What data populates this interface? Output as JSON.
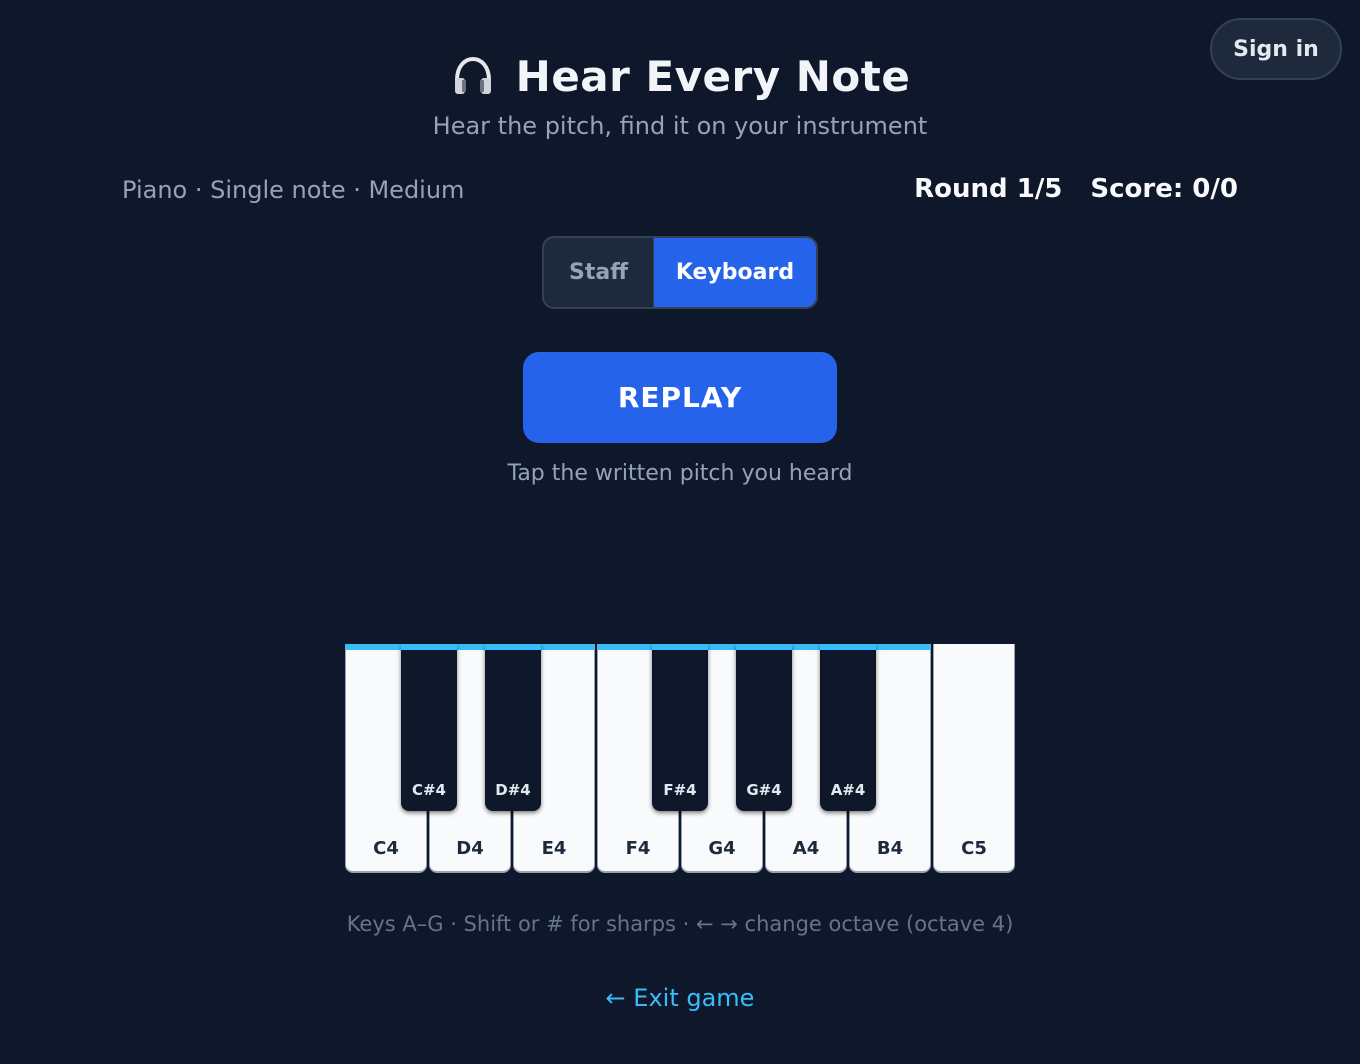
{
  "header": {
    "icon": "headphones-icon",
    "title": "Hear Every Note",
    "subtitle": "Hear the pitch, find it on your instrument",
    "signin_label": "Sign in"
  },
  "game": {
    "mode_text": "Piano · Single note · Medium",
    "round_text": "Round 1/5",
    "score_text": "Score: 0/0"
  },
  "view_toggle": {
    "options": [
      "Staff",
      "Keyboard"
    ],
    "selected": "Keyboard"
  },
  "replay_label": "REPLAY",
  "prompt_text": "Tap the written pitch you heard",
  "keyboard": {
    "octave": 4,
    "white_keys": [
      "C4",
      "D4",
      "E4",
      "F4",
      "G4",
      "A4",
      "B4",
      "C5"
    ],
    "black_keys": [
      "C#4",
      "D#4",
      "F#4",
      "G#4",
      "A#4"
    ],
    "highlight_color": "#38bdf8"
  },
  "hint_text": "Keys A–G · Shift or # for sharps · ← → change octave (octave 4)",
  "exit_label": "← Exit game",
  "colors": {
    "background": "#0f172a",
    "accent": "#2563eb",
    "link": "#38bdf8"
  }
}
